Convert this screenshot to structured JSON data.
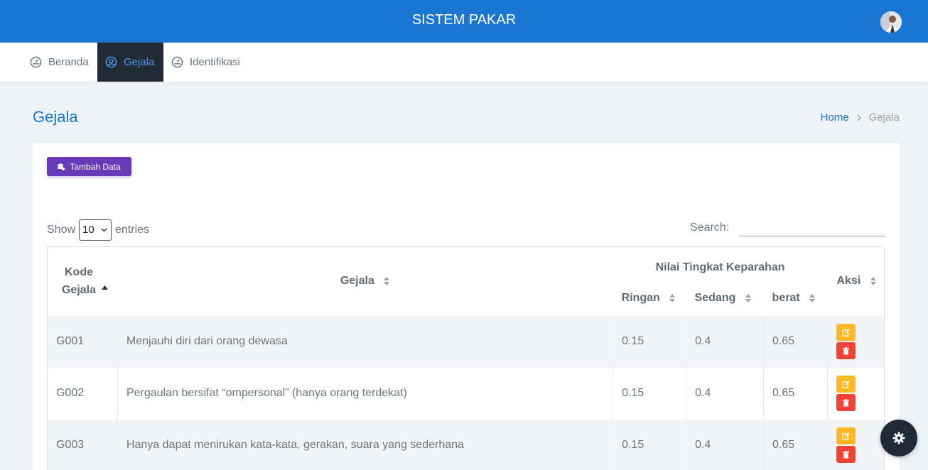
{
  "header": {
    "title": "SISTEM PAKAR",
    "avatar_icon": "user-avatar"
  },
  "nav": {
    "items": [
      {
        "label": "Beranda",
        "icon": "dashboard-icon",
        "active": false
      },
      {
        "label": "Gejala",
        "icon": "user-circle-icon",
        "active": true
      },
      {
        "label": "Identifikasi",
        "icon": "dashboard-icon",
        "active": false
      }
    ]
  },
  "page": {
    "title": "Gejala"
  },
  "breadcrumb": {
    "home": "Home",
    "current": "Gejala"
  },
  "toolbar": {
    "add_label": "Tambah Data"
  },
  "entries": {
    "show_label": "Show",
    "value": "10",
    "suffix": "entries"
  },
  "search": {
    "label": "Search:",
    "value": ""
  },
  "table": {
    "headers": {
      "kode": "Kode Gejala",
      "gejala": "Gejala",
      "group": "Nilai Tingkat Keparahan",
      "ringan": "Ringan",
      "sedang": "Sedang",
      "berat": "berat",
      "aksi": "Aksi"
    },
    "rows": [
      {
        "kode": "G001",
        "gejala": "Menjauhi diri dari orang dewasa",
        "ringan": "0.15",
        "sedang": "0.4",
        "berat": "0.65"
      },
      {
        "kode": "G002",
        "gejala": "Pergaulan bersifat “ompersonal” (hanya orang terdekat)",
        "ringan": "0.15",
        "sedang": "0.4",
        "berat": "0.65"
      },
      {
        "kode": "G003",
        "gejala": "Hanya dapat menirukan kata-kata, gerakan, suara yang sederhana",
        "ringan": "0.15",
        "sedang": "0.4",
        "berat": "0.65"
      }
    ]
  },
  "colors": {
    "primary": "#1976d2",
    "nav_active_bg": "#212b36",
    "add_button": "#673ab7",
    "edit_button": "#ffb822",
    "delete_button": "#f44336"
  },
  "fab": {
    "icon": "gear-icon"
  }
}
